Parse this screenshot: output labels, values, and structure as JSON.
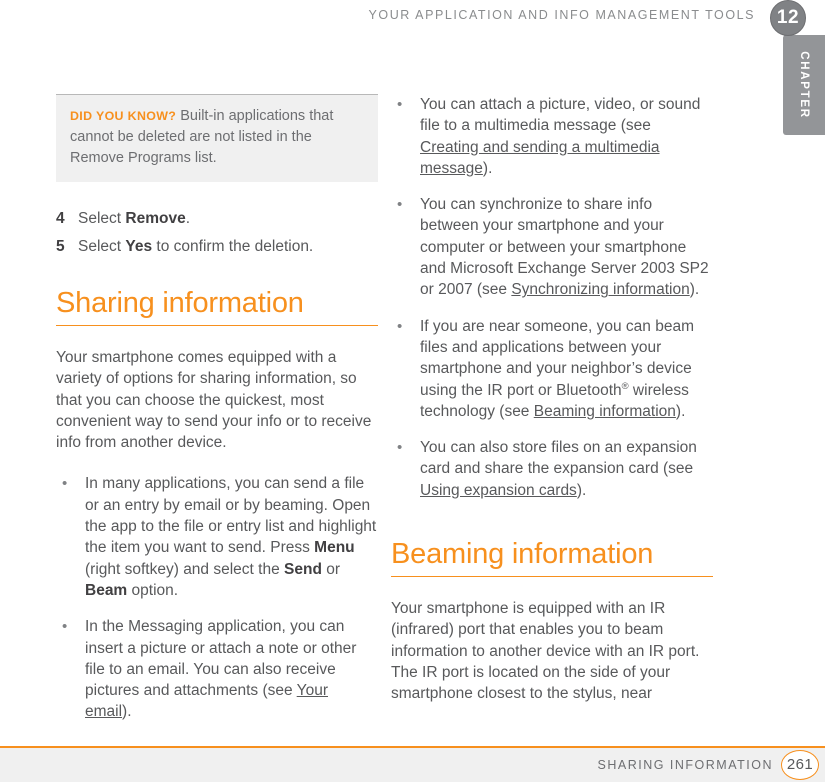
{
  "running_head": {
    "title": "YOUR APPLICATION AND INFO MANAGEMENT TOOLS"
  },
  "chapter_tab": {
    "label": "CHAPTER",
    "number": "12",
    "color": "#939598"
  },
  "callout": {
    "kicker": "DID YOU KNOW?",
    "text": "Built-in applications that cannot be deleted are not listed in the Remove Programs list.",
    "background": "#f0f0f0"
  },
  "steps": [
    {
      "number": "4",
      "prefix": "Select ",
      "bold": "Remove",
      "suffix": "."
    },
    {
      "number": "5",
      "prefix": "Select ",
      "bold": "Yes",
      "suffix": " to confirm the deletion."
    }
  ],
  "sections": {
    "sharing": {
      "heading": "Sharing information",
      "intro": "Your smartphone comes equipped with a variety of options for sharing information, so that you can choose the quickest, most convenient way to send your info or to receive info from another device."
    },
    "beaming": {
      "heading": "Beaming information",
      "intro": "Your smartphone is equipped with an IR (infrared) port that enables you to beam information to another device with an IR port. The IR port is located on the side of your smartphone closest to the stylus, near"
    }
  },
  "bullets_left": [
    {
      "marker": "•",
      "seg1": "In many applications, you can send a file or an entry by email or by beaming. Open the app to the file or entry list and highlight the item you want to send. Press ",
      "bold1": "Menu",
      "seg2": " (right softkey) and select the ",
      "bold2": "Send",
      "seg3": " or ",
      "bold3": "Beam",
      "seg4": " option."
    },
    {
      "marker": "•",
      "seg1": "In the Messaging application, you can insert a picture or attach a note or other file to an email. You can also receive pictures and attachments (see ",
      "link": "Your email",
      "seg2": ")."
    }
  ],
  "bullets_right": [
    {
      "marker": "•",
      "seg1": "You can attach a picture, video, or sound file to a multimedia message (see ",
      "link": "Creating and sending a multimedia message",
      "seg2": ")."
    },
    {
      "marker": "•",
      "seg1": "You can synchronize to share info between your smartphone and your computer or between your smartphone and Microsoft Exchange Server 2003 SP2 or 2007 (see ",
      "link": "Synchronizing information",
      "seg2": ")."
    },
    {
      "marker": "•",
      "seg1": "If you are near someone, you can beam files and applications between your smartphone and your neighbor’s device using the IR port or Bluetooth",
      "superscript": "®",
      "seg2": " wireless technology (see ",
      "link": "Beaming information",
      "seg3": ")."
    },
    {
      "marker": "•",
      "seg1": "You can also store files on an expansion card and share the expansion card (see ",
      "link": "Using expansion cards",
      "seg2": ")."
    }
  ],
  "footer": {
    "title": "SHARING INFORMATION",
    "page_number": "261",
    "accent_color": "#f7901e"
  }
}
